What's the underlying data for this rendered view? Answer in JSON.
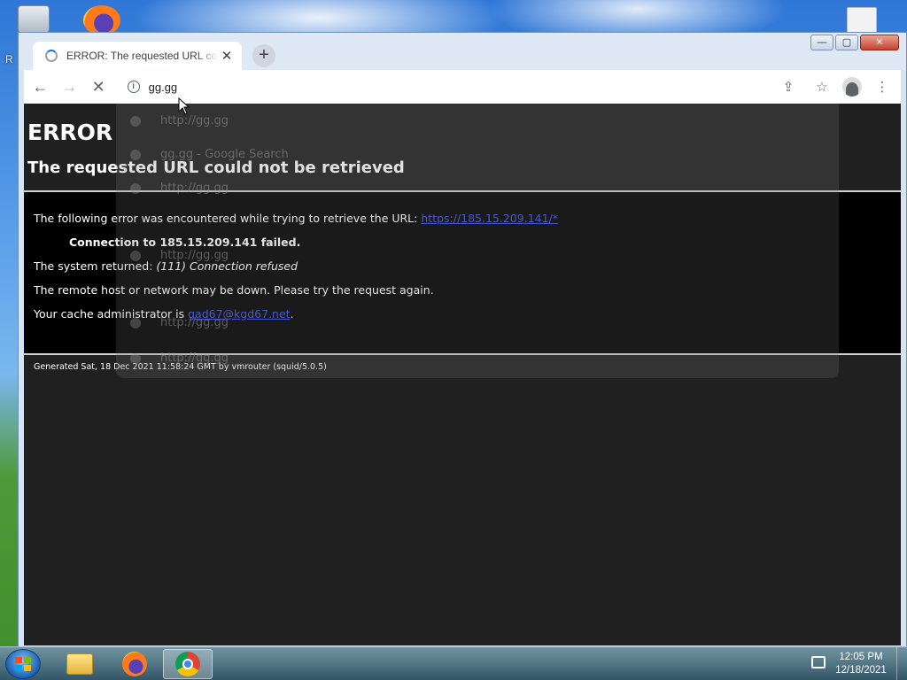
{
  "desktop": {
    "partial_label": "R"
  },
  "browser": {
    "tab": {
      "title": "ERROR: The requested URL could not be retrieved"
    },
    "new_tab_symbol": "+",
    "window_controls": {
      "minimize": "—",
      "maximize": "▢",
      "close": "✕"
    },
    "toolbar": {
      "back_symbol": "←",
      "forward_symbol": "→",
      "stop_symbol": "✕",
      "info_symbol": "i",
      "address_value": "gg.gg",
      "share_symbol": "⇪",
      "bookmark_symbol": "☆",
      "menu_symbol": "⋮"
    }
  },
  "page": {
    "title": "ERROR",
    "subtitle": "The requested URL could not be retrieved",
    "line1_text": "The following error was encountered while trying to retrieve the URL: ",
    "line1_link": "https://185.15.209.141/*",
    "line2": "Connection to 185.15.209.141 failed.",
    "line3_prefix": "The system returned: ",
    "line3_em": "(111) Connection refused",
    "line4": "The remote host or network may be down. Please try the request again.",
    "line5_prefix": "Your cache administrator is ",
    "line5_link": "gad67@kgd67.net",
    "line5_suffix": ".",
    "footer": "Generated Sat, 18 Dec 2021 11:58:24 GMT by vmrouter (squid/5.0.5)"
  },
  "suggestions": [
    "http://gg.gg",
    "gg.gg - Google Search",
    "http://gg.gg",
    "http://gg.gg",
    "http://gg.gg",
    "http://gg.gg"
  ],
  "taskbar": {
    "clock_time": "12:05 PM",
    "clock_date": "12/18/2021"
  },
  "colors": {
    "page_bg": "#202020",
    "content_bg": "#000000",
    "link": "#3b4ee8"
  }
}
